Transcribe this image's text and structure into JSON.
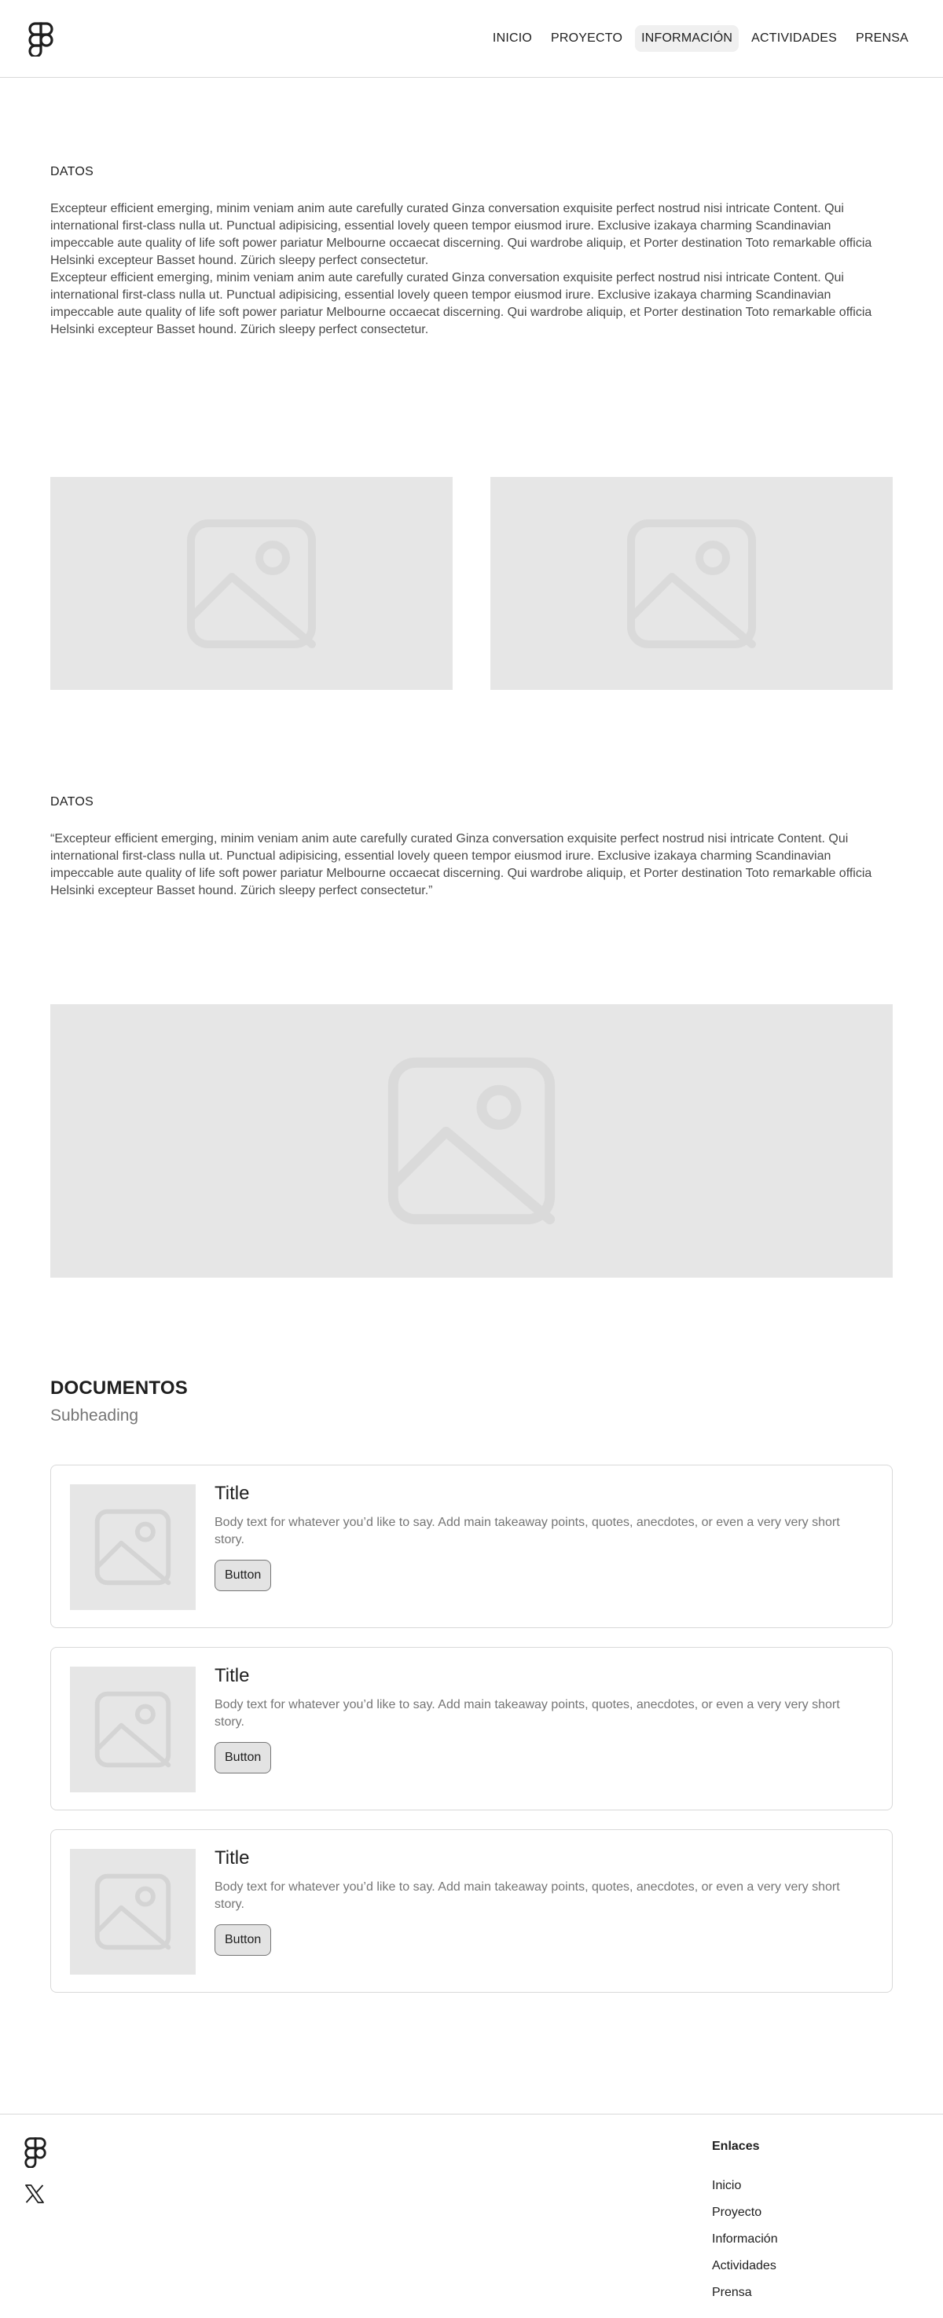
{
  "header": {
    "nav": [
      "INICIO",
      "PROYECTO",
      "INFORMACIÓN",
      "ACTIVIDADES",
      "PRENSA"
    ],
    "active_nav": "INFORMACIÓN"
  },
  "section1": {
    "label": "DATOS",
    "paragraph1": "Excepteur efficient emerging, minim veniam anim aute carefully curated Ginza conversation exquisite perfect nostrud nisi intricate Content. Qui  international first-class nulla ut. Punctual adipisicing, essential lovely queen tempor eiusmod irure. Exclusive izakaya charming Scandinavian impeccable aute quality of life soft power pariatur Melbourne occaecat discerning. Qui wardrobe aliquip, et Porter destination Toto remarkable officia Helsinki excepteur Basset hound. Zürich sleepy perfect consectetur.",
    "paragraph2": "Excepteur efficient emerging, minim veniam anim aute carefully curated Ginza conversation exquisite perfect nostrud nisi intricate Content. Qui  international first-class nulla ut. Punctual adipisicing, essential lovely queen tempor eiusmod irure. Exclusive izakaya charming Scandinavian impeccable aute quality of life soft power pariatur Melbourne occaecat discerning. Qui wardrobe aliquip, et Porter destination Toto remarkable officia Helsinki excepteur Basset hound. Zürich sleepy perfect consectetur."
  },
  "section2": {
    "label": "DATOS",
    "quote": "“Excepteur efficient emerging, minim veniam anim aute carefully curated Ginza conversation exquisite perfect nostrud nisi intricate Content. Qui  international first-class nulla ut. Punctual adipisicing, essential lovely queen tempor eiusmod irure. Exclusive izakaya charming Scandinavian impeccable aute quality of life soft power pariatur Melbourne occaecat discerning. Qui wardrobe aliquip, et Porter destination Toto remarkable officia Helsinki excepteur Basset hound. Zürich sleepy perfect consectetur.”"
  },
  "documents": {
    "heading": "DOCUMENTOS",
    "subheading": "Subheading",
    "cards": [
      {
        "title": "Title",
        "body": "Body text for whatever you’d like to say. Add main takeaway points, quotes, anecdotes, or even a very very short story.",
        "button": "Button"
      },
      {
        "title": "Title",
        "body": "Body text for whatever you’d like to say. Add main takeaway points, quotes, anecdotes, or even a very very short story.",
        "button": "Button"
      },
      {
        "title": "Title",
        "body": "Body text for whatever you’d like to say. Add main takeaway points, quotes, anecdotes, or even a very very short story.",
        "button": "Button"
      }
    ]
  },
  "footer": {
    "column_title": "Enlaces",
    "links": [
      "Inicio",
      "Proyecto",
      "Información",
      "Actividades",
      "Prensa"
    ]
  },
  "icons": {
    "logo": "figma-logo-icon",
    "image_placeholder": "image-icon",
    "social": "x-twitter-icon"
  },
  "colors": {
    "placeholder_bg": "#e6e6e6",
    "placeholder_icon": "#dadada",
    "border": "#d9d9d9",
    "body_text": "#4a4a4a",
    "muted_text": "#757575"
  }
}
